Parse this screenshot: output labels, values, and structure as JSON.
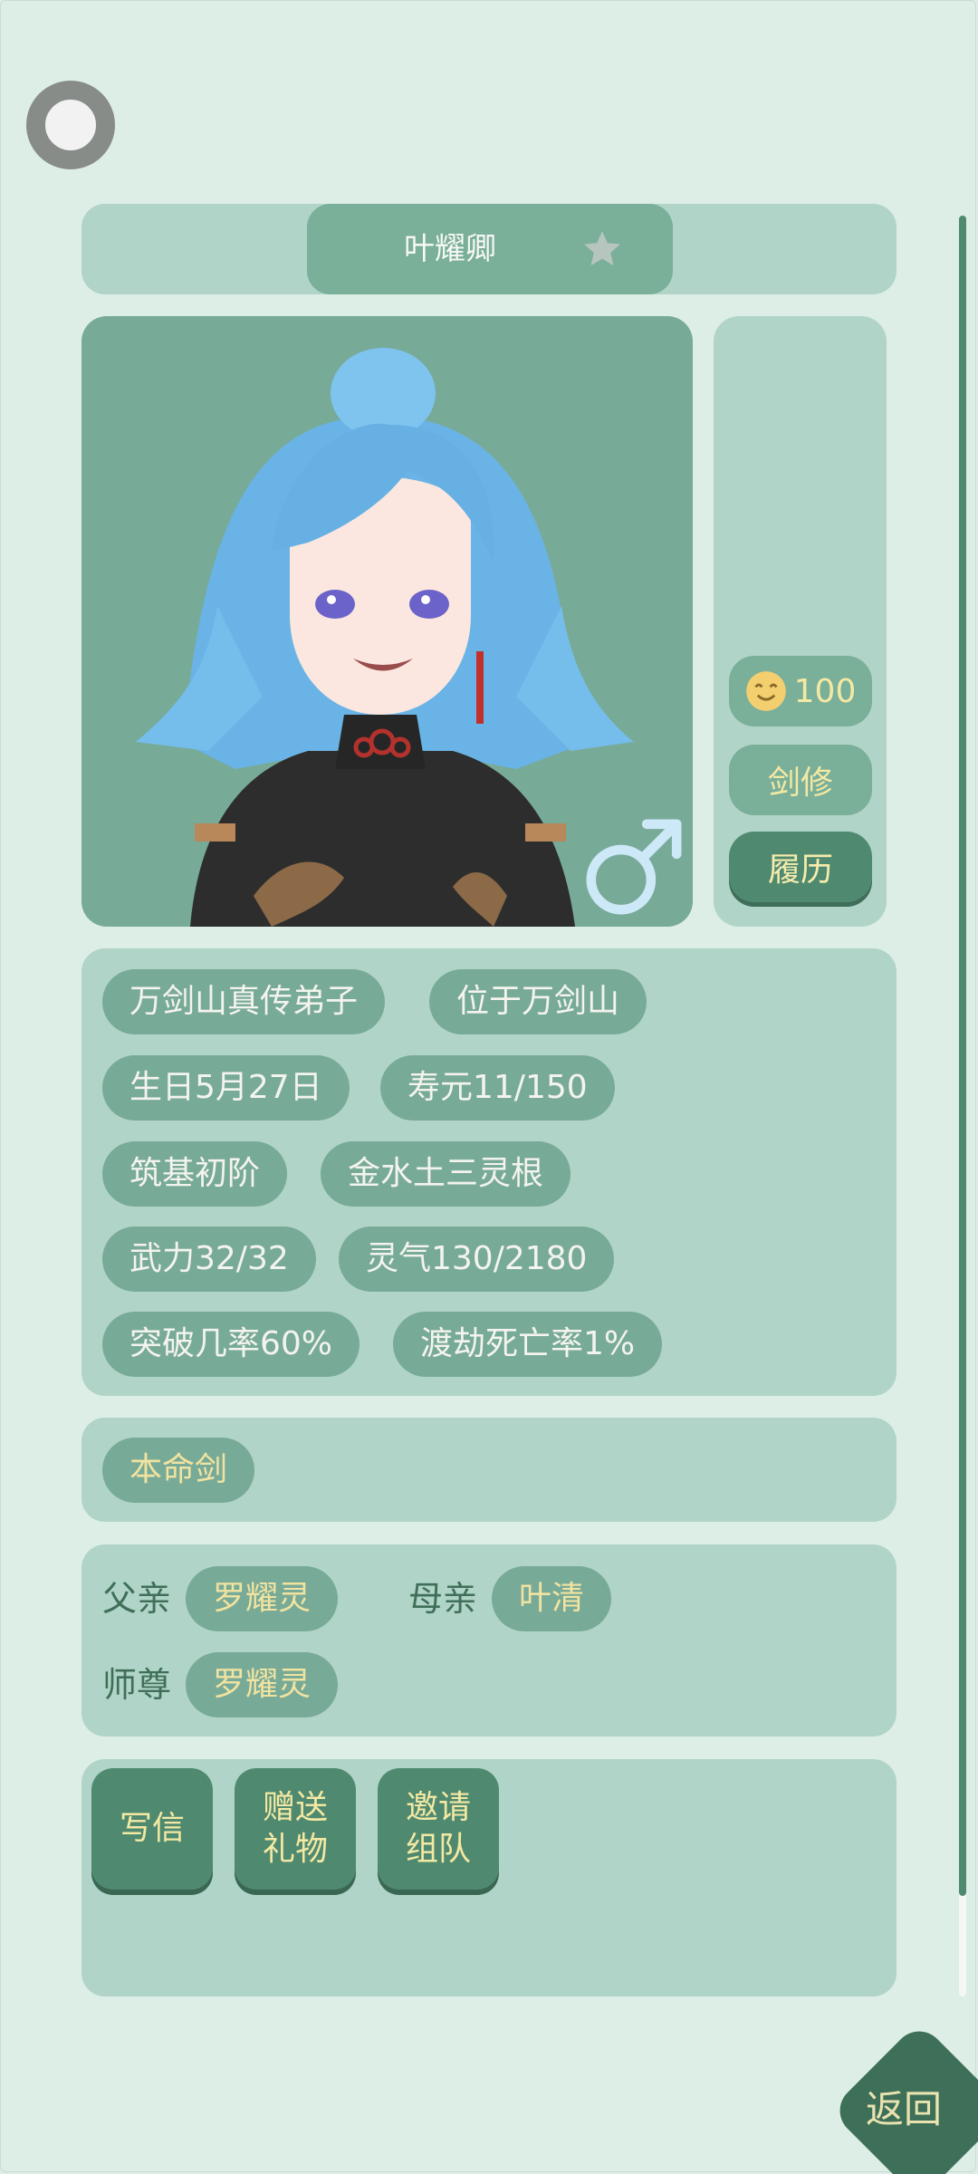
{
  "header": {
    "name": "叶耀卿"
  },
  "side": {
    "mood_value": "100",
    "class_label": "剑修",
    "resume_button": "履历"
  },
  "info_chips": [
    "万剑山真传弟子",
    "位于万剑山",
    "生日5月27日",
    "寿元11/150",
    "筑基初阶",
    "金水土三灵根",
    "武力32/32",
    "灵气130/2180",
    "突破几率60%",
    "渡劫死亡率1%"
  ],
  "equipment": {
    "item": "本命剑"
  },
  "relations": {
    "father_label": "父亲",
    "father_name": "罗耀灵",
    "mother_label": "母亲",
    "mother_name": "叶清",
    "master_label": "师尊",
    "master_name": "罗耀灵"
  },
  "actions": {
    "write_letter": "写信",
    "gift_line1": "赠送",
    "gift_line2": "礼物",
    "invite_line1": "邀请",
    "invite_line2": "组队"
  },
  "footer": {
    "back_label": "返回"
  },
  "colors": {
    "background": "#ddeee6",
    "panel": "#b0d4c7",
    "chip": "#78aa98",
    "button": "#4f8a70",
    "accent_text": "#f4e9a3",
    "male_symbol": "#cde8f7"
  }
}
